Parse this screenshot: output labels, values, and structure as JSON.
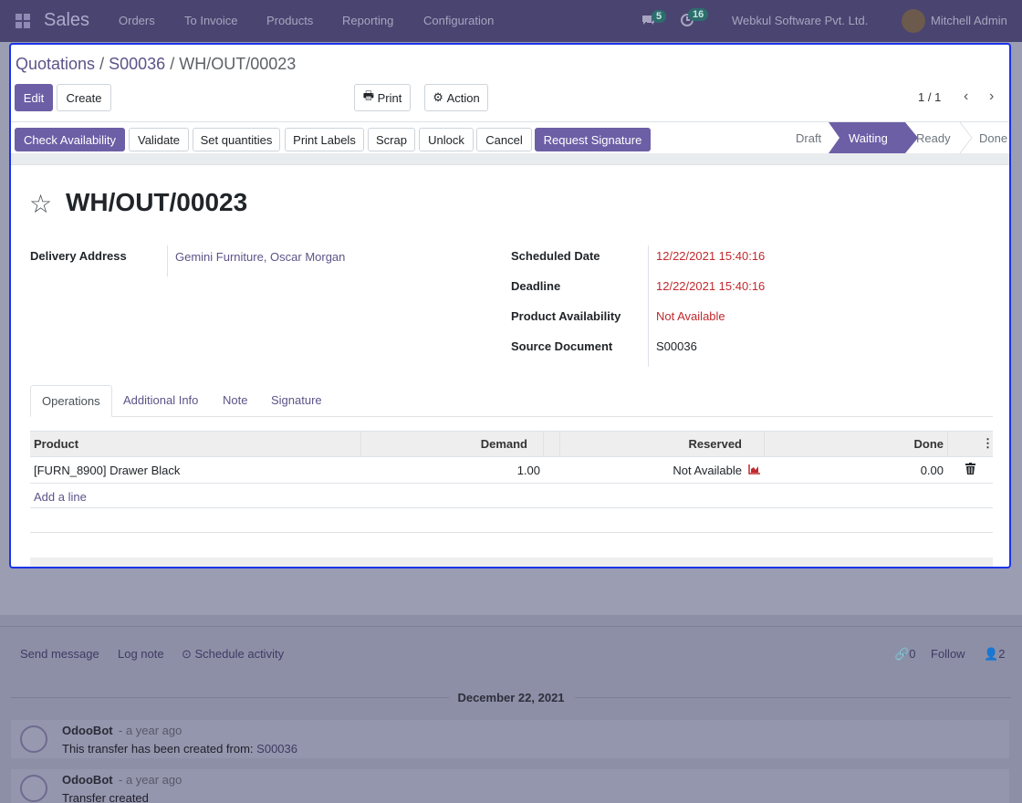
{
  "navbar": {
    "brand": "Sales",
    "menu": [
      "Orders",
      "To Invoice",
      "Products",
      "Reporting",
      "Configuration"
    ],
    "messages_count": "5",
    "activities_count": "16",
    "company": "Webkul Software Pvt. Ltd.",
    "user": "Mitchell Admin"
  },
  "breadcrumb": {
    "root": "Quotations",
    "sep": "/",
    "parent": "S00036",
    "current": "WH/OUT/00023"
  },
  "control": {
    "edit": "Edit",
    "create": "Create",
    "print": "Print",
    "action": "Action",
    "pager": "1 / 1"
  },
  "statusbar": {
    "buttons": [
      "Check Availability",
      "Validate",
      "Set quantities",
      "Print Labels",
      "Scrap",
      "Unlock",
      "Cancel",
      "Request Signature"
    ],
    "stages": [
      "Draft",
      "Waiting",
      "Ready",
      "Done"
    ],
    "active_stage": "Waiting"
  },
  "record": {
    "title": "WH/OUT/00023",
    "delivery_address_label": "Delivery Address",
    "delivery_address": "Gemini Furniture, Oscar Morgan",
    "scheduled_date_label": "Scheduled Date",
    "scheduled_date": "12/22/2021 15:40:16",
    "deadline_label": "Deadline",
    "deadline": "12/22/2021 15:40:16",
    "availability_label": "Product Availability",
    "availability": "Not Available",
    "source_label": "Source Document",
    "source": "S00036"
  },
  "tabs": [
    "Operations",
    "Additional Info",
    "Note",
    "Signature"
  ],
  "table": {
    "columns": [
      "Product",
      "Demand",
      "Reserved",
      "Done"
    ],
    "rows": [
      {
        "product": "[FURN_8900] Drawer Black",
        "demand": "1.00",
        "reserved": "Not Available",
        "done": "0.00"
      }
    ],
    "add_line": "Add a line"
  },
  "chatter": {
    "send_message": "Send message",
    "log_note": "Log note",
    "schedule_activity": "Schedule activity",
    "attachments": "0",
    "follow": "Follow",
    "followers": "2",
    "date": "December 22, 2021",
    "messages": [
      {
        "author": "OdooBot",
        "time": "- a year ago",
        "body": "This transfer has been created from:",
        "link": "S00036"
      },
      {
        "author": "OdooBot",
        "time": "- a year ago",
        "body": "Transfer created"
      }
    ]
  },
  "colors": {
    "brand": "#4a4470",
    "primary": "#6c5fa6",
    "danger": "#c1292e",
    "focus_border": "#1a33e8"
  }
}
